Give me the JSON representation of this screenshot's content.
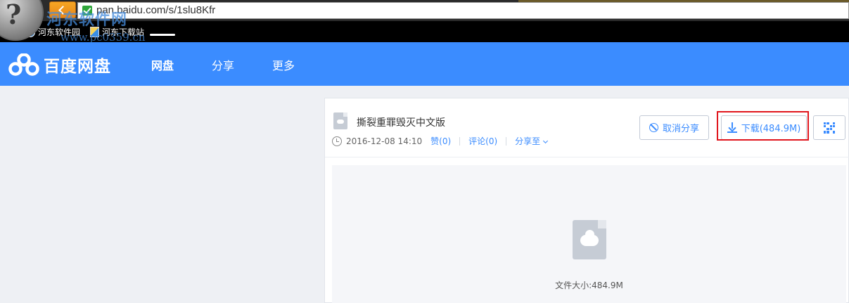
{
  "browser": {
    "url": "pan.baidu.com/s/1slu8Kfr",
    "bookmarks": [
      "河东软件园",
      "河东下载站"
    ],
    "watermark": "河东软件网",
    "watermark_sub": "www.pc0359.cn"
  },
  "header": {
    "logo_text": "百度网盘",
    "nav": [
      "网盘",
      "分享",
      "更多"
    ],
    "active_nav": "网盘"
  },
  "file": {
    "title": "撕裂重罪毁灭中文版",
    "datetime": "2016-12-08 14:10",
    "like": "赞(0)",
    "comment": "评论(0)",
    "share_to": "分享至",
    "size_label": "文件大小:484.9M"
  },
  "actions": {
    "cancel_share": "取消分享",
    "download": "下载(484.9M)"
  },
  "colors": {
    "header_bg": "#3b8cff",
    "accent": "#3b8cff",
    "highlight": "#e0161d"
  }
}
